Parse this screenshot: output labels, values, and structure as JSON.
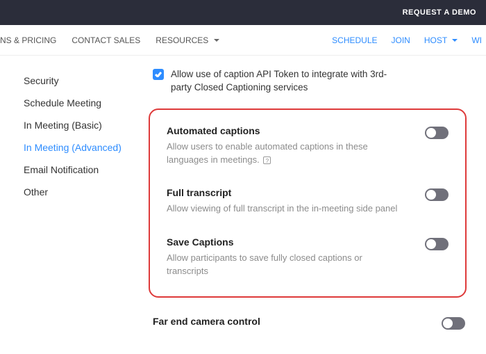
{
  "topbar": {
    "cta": "REQUEST A DEMO"
  },
  "nav": {
    "left": [
      {
        "label": "NS & PRICING"
      },
      {
        "label": "CONTACT SALES"
      },
      {
        "label": "RESOURCES"
      }
    ],
    "right": [
      {
        "label": "SCHEDULE"
      },
      {
        "label": "JOIN"
      },
      {
        "label": "HOST"
      },
      {
        "label": "WI"
      }
    ]
  },
  "sidebar": {
    "items": [
      {
        "label": "Security"
      },
      {
        "label": "Schedule Meeting"
      },
      {
        "label": "In Meeting (Basic)"
      },
      {
        "label": "In Meeting (Advanced)"
      },
      {
        "label": "Email Notification"
      },
      {
        "label": "Other"
      }
    ],
    "activeIndex": 3
  },
  "checkbox_setting": {
    "label": "Allow use of caption API Token to integrate with 3rd-party Closed Captioning services"
  },
  "settings": [
    {
      "title": "Automated captions",
      "desc": "Allow users to enable automated captions in these languages in meetings.",
      "info": true
    },
    {
      "title": "Full transcript",
      "desc": "Allow viewing of full transcript in the in-meeting side panel",
      "info": false
    },
    {
      "title": "Save Captions",
      "desc": "Allow participants to save fully closed captions or transcripts",
      "info": false
    }
  ],
  "below_setting": {
    "title": "Far end camera control"
  }
}
